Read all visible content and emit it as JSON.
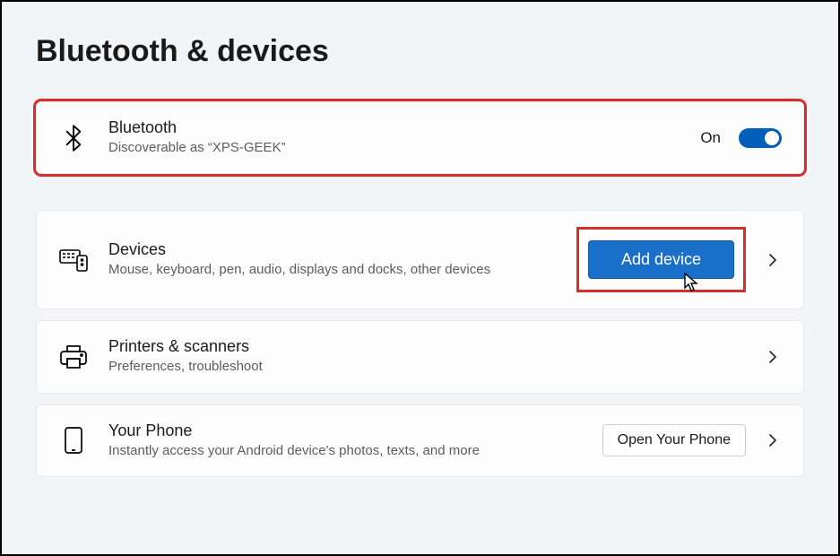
{
  "pageTitle": "Bluetooth & devices",
  "bluetooth": {
    "title": "Bluetooth",
    "subtitle": "Discoverable as “XPS-GEEK”",
    "status": "On"
  },
  "devices": {
    "title": "Devices",
    "subtitle": "Mouse, keyboard, pen, audio, displays and docks, other devices",
    "buttonLabel": "Add device"
  },
  "printers": {
    "title": "Printers & scanners",
    "subtitle": "Preferences, troubleshoot"
  },
  "yourPhone": {
    "title": "Your Phone",
    "subtitle": "Instantly access your Android device's photos, texts, and more",
    "buttonLabel": "Open Your Phone"
  }
}
